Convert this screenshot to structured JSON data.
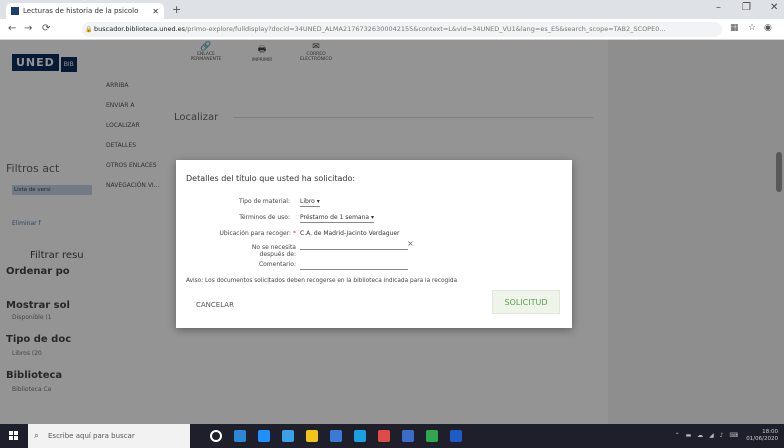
{
  "browser": {
    "tab_title": "Lecturas de historia de la psicolo",
    "tab_close": "✕",
    "new_tab": "+",
    "window_controls": [
      "–",
      "❐",
      "✕"
    ],
    "url_host": "buscador.biblioteca.uned.es",
    "url_path": "/primo-explore/fulldisplay?docid=34UNED_ALMA21767326300042155&context=L&vid=34UNED_VU1&lang=es_ES&search_scope=TAB2_SCOPE0..."
  },
  "sidebar": {
    "logo": "UNED",
    "logo_small": "BIB",
    "filtros": "Filtros act",
    "chip": "Lista de versi",
    "eliminar": "Eliminar f",
    "filtrar": "Filtrar resu",
    "sections": [
      {
        "title": "Ordenar po",
        "sub": ""
      },
      {
        "title": "Mostrar sol",
        "sub": "Disponible (1"
      },
      {
        "title": "Tipo de doc",
        "sub": "Libros (20"
      },
      {
        "title": "Biblioteca",
        "sub": "Biblioteca Ce"
      }
    ]
  },
  "record": {
    "actions": [
      {
        "icon": "link-icon",
        "glyph": "🔗",
        "label": "ENLACE PERMANENTE"
      },
      {
        "icon": "print-icon",
        "glyph": "🖶",
        "label": "IMPRIMIR"
      },
      {
        "icon": "mail-icon",
        "glyph": "✉",
        "label": "CORREO ELECTRÓNICO"
      }
    ],
    "nav": [
      "ARRIBA",
      "ENVIAR A",
      "LOCALIZAR",
      "DETALLES",
      "OTROS ENLACES",
      "NAVEGACIÓN VI..."
    ],
    "section_heading": "Localizar"
  },
  "modal": {
    "title": "Detalles del título que usted ha solicitado:",
    "tipo_label": "Tipo de material:",
    "tipo_value": "Libro ▾",
    "terminos_label": "Términos de uso:",
    "terminos_value": "Préstamo de 1 semana ▾",
    "ubicacion_label": "Ubicación para recoger:",
    "ubicacion_required": "*",
    "ubicacion_value": "C.A. de Madrid-Jacinto Verdaguer",
    "recoger_label": "No se necesita después de:",
    "recoger_clear": "×",
    "comentario_label": "Comentario:",
    "aviso": "Aviso: Los documentos solicitados deben recogerse en la biblioteca indicada para la recogida",
    "cancel": "CANCELAR",
    "submit": "SOLICITUD"
  },
  "taskbar": {
    "search_placeholder": "Escribe aquí para buscar",
    "time": "18:00",
    "date": "01/06/2020",
    "app_colors": [
      "#ffffff",
      "#2b88d8",
      "#1e90ff",
      "#3aa0e8",
      "#f0c419",
      "#3c78d8",
      "#1ba1e2",
      "#e04a4a",
      "#3b6cc8",
      "#2fa84f",
      "#1e5bc6"
    ]
  }
}
